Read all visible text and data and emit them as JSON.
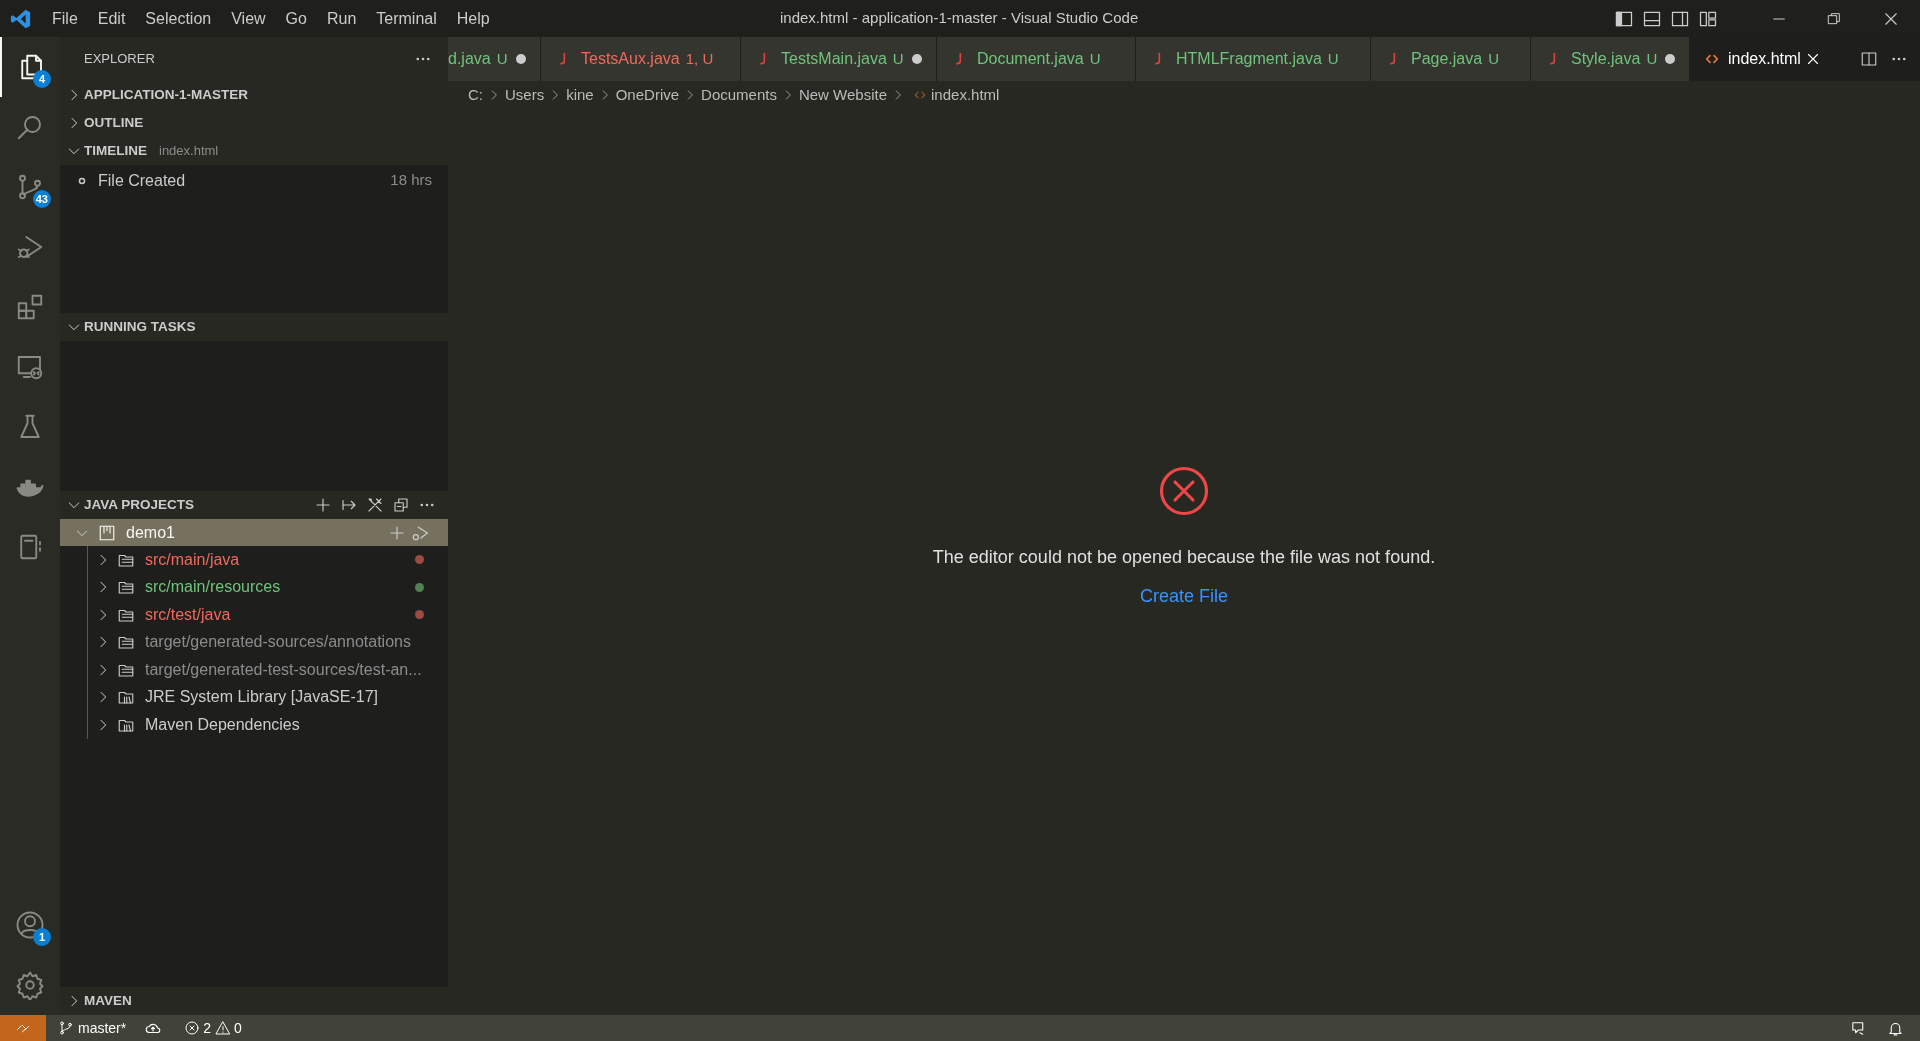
{
  "title_bar": {
    "menu": [
      "File",
      "Edit",
      "Selection",
      "View",
      "Go",
      "Run",
      "Terminal",
      "Help"
    ],
    "title": "index.html - application-1-master - Visual Studio Code"
  },
  "activity_bar": {
    "items": [
      {
        "kind": "explorer",
        "selected": true,
        "badge": "4"
      },
      {
        "kind": "search",
        "selected": false
      },
      {
        "kind": "source-control",
        "selected": false,
        "badge": "43"
      },
      {
        "kind": "run",
        "selected": false
      },
      {
        "kind": "extensions",
        "selected": false
      },
      {
        "kind": "remote",
        "selected": false
      },
      {
        "kind": "testing",
        "selected": false
      },
      {
        "kind": "docker",
        "selected": false
      },
      {
        "kind": "notebook",
        "selected": false
      }
    ],
    "bottom": [
      {
        "kind": "accounts",
        "badge": "1"
      },
      {
        "kind": "settings"
      }
    ]
  },
  "sidebar": {
    "title": "EXPLORER",
    "sections": [
      {
        "title": "APPLICATION-1-MASTER",
        "expanded": false
      },
      {
        "title": "OUTLINE",
        "expanded": false
      },
      {
        "title": "TIMELINE",
        "expanded": true,
        "description": "index.html",
        "items": [
          {
            "label": "File Created",
            "time": "18 hrs"
          }
        ]
      },
      {
        "title": "RUNNING TASKS",
        "expanded": true
      },
      {
        "title": "JAVA PROJECTS",
        "expanded": true,
        "tree": [
          {
            "label": "demo1",
            "kind": "project",
            "expanded": true,
            "selected": true,
            "children": [
              {
                "label": "src/main/java",
                "kind": "folder",
                "color": "#f0695c",
                "dot": true,
                "expanded": false
              },
              {
                "label": "src/main/resources",
                "kind": "folder",
                "color": "#6fc37c",
                "dot": true,
                "expanded": false
              },
              {
                "label": "src/test/java",
                "kind": "folder",
                "color": "#f0695c",
                "dot": true,
                "expanded": false
              },
              {
                "label": "target/generated-sources/annotations",
                "kind": "folder",
                "color": "#8c8c8c",
                "dot": false,
                "expanded": false
              },
              {
                "label": "target/generated-test-sources/test-an...",
                "kind": "folder",
                "color": "#8c8c8c",
                "dot": false,
                "expanded": false
              },
              {
                "label": "JRE System Library [JavaSE-17]",
                "kind": "library",
                "color": "#cccccc",
                "dot": false,
                "expanded": false
              },
              {
                "label": "Maven Dependencies",
                "kind": "library",
                "color": "#cccccc",
                "dot": false,
                "expanded": false
              }
            ]
          }
        ]
      },
      {
        "title": "MAVEN",
        "expanded": false
      }
    ]
  },
  "tabs": [
    {
      "label": "d.java",
      "color": "#6fc37c",
      "decoration": "U",
      "dirty": true,
      "selected": false
    },
    {
      "label": "TestsAux.java",
      "kind": "java",
      "color": "#f0695c",
      "decoration": "1, U",
      "dirty": false,
      "selected": false
    },
    {
      "label": "TestsMain.java",
      "kind": "java",
      "color": "#6fc37c",
      "decoration": "U",
      "dirty": true,
      "selected": false
    },
    {
      "label": "Document.java",
      "kind": "java",
      "color": "#6fc37c",
      "decoration": "U",
      "dirty": false,
      "selected": false
    },
    {
      "label": "HTMLFragment.java",
      "kind": "java",
      "color": "#6fc37c",
      "decoration": "U",
      "dirty": false,
      "selected": false
    },
    {
      "label": "Page.java",
      "kind": "java",
      "color": "#6fc37c",
      "decoration": "U",
      "dirty": false,
      "selected": false
    },
    {
      "label": "Style.java",
      "kind": "java",
      "color": "#6fc37c",
      "decoration": "U",
      "dirty": true,
      "selected": false
    },
    {
      "label": "index.html",
      "kind": "html",
      "color": "#ffffff",
      "dirty": false,
      "selected": true
    }
  ],
  "breadcrumbs": [
    "C:",
    "Users",
    "kine",
    "OneDrive",
    "Documents",
    "New Website",
    "index.html"
  ],
  "editor": {
    "message": "The editor could not be opened because the file was not found.",
    "action": "Create File"
  },
  "status_bar": {
    "branch": "master*",
    "errors": "2",
    "warnings": "0"
  }
}
